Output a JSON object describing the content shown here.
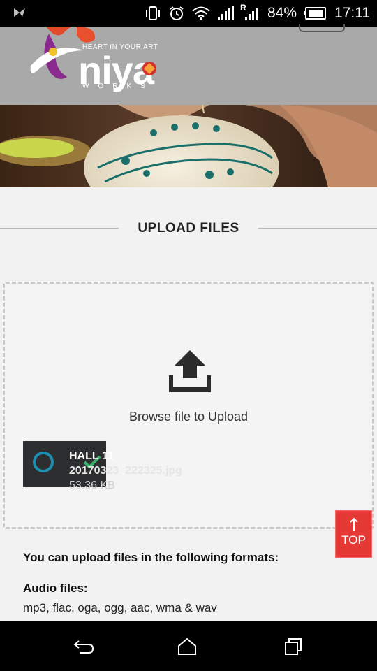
{
  "status_bar": {
    "battery": "84%",
    "time": "17:11",
    "network_label": "R"
  },
  "header": {
    "logo_tagline": "HEART IN YOUR ART",
    "logo_wordmark": "niya",
    "logo_subtitle": "WORKS"
  },
  "upload": {
    "section_title": "UPLOAD FILES",
    "browse_label": "Browse file to Upload",
    "file": {
      "name_line1": "HALL 11",
      "name_line2": "20170323_222325.jpg",
      "size": "53.36 KB"
    }
  },
  "top_button": {
    "label": "TOP"
  },
  "formats": {
    "heading": "You can upload files in the following formats:",
    "audio_heading": "Audio files:",
    "audio_list": "mp3, flac, oga, ogg, aac, wma & wav"
  },
  "colors": {
    "accent_red": "#e53935",
    "header_gray": "#a9a9a9",
    "spinner_blue": "#1e8fb0",
    "check_green": "#3bb36a"
  }
}
